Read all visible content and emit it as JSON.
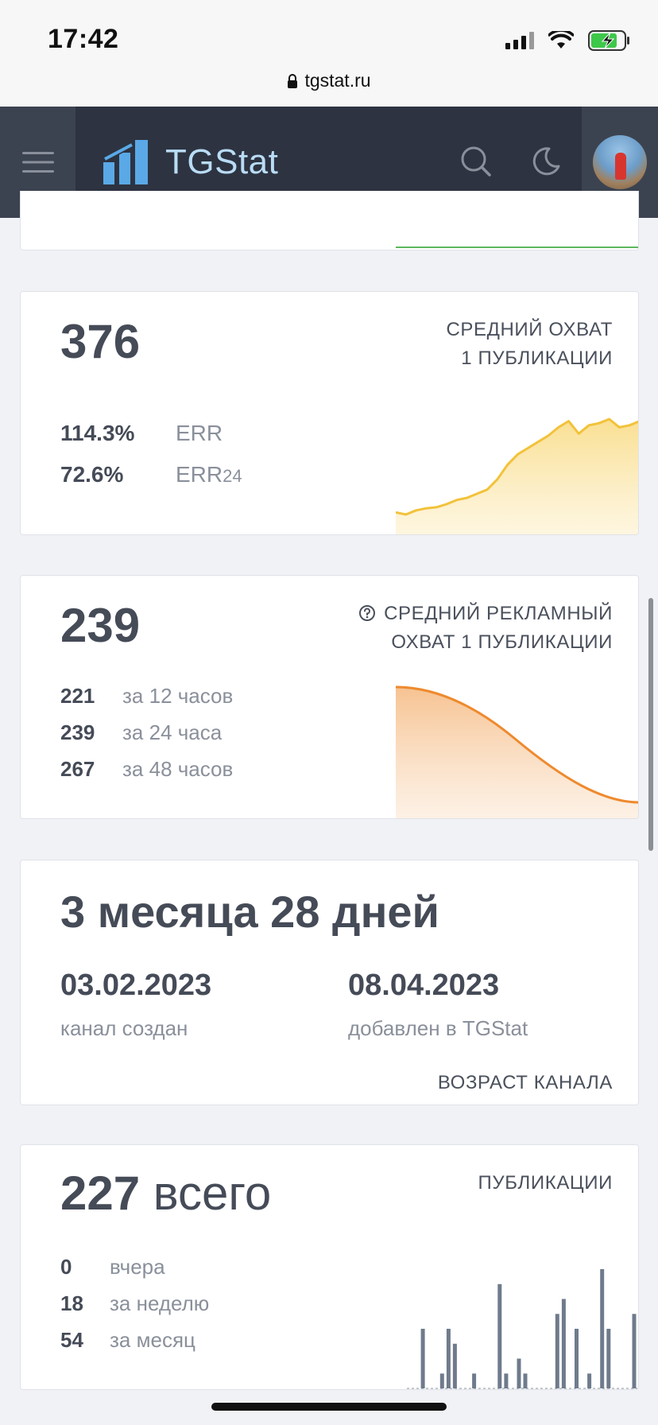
{
  "status": {
    "time": "17:42"
  },
  "browser": {
    "url": "tgstat.ru"
  },
  "header": {
    "brand": "TGStat"
  },
  "reach": {
    "value": "376",
    "title_line1": "СРЕДНИЙ ОХВАТ",
    "title_line2": "1 ПУБЛИКАЦИИ",
    "err_value": "114.3%",
    "err_label": "ERR",
    "err24_value": "72.6%",
    "err24_label": "ERR",
    "err24_sub": "24",
    "trend": [
      12,
      10,
      14,
      16,
      17,
      20,
      24,
      26,
      30,
      34,
      44,
      58,
      68,
      74,
      80,
      86,
      94,
      100,
      88,
      96,
      98,
      102,
      94,
      96,
      100
    ]
  },
  "ad_reach": {
    "value": "239",
    "title_line1": "СРЕДНИЙ РЕКЛАМНЫЙ",
    "title_line2": "ОХВАТ 1 ПУБЛИКАЦИИ",
    "rows": [
      {
        "value": "221",
        "label": "за 12 часов"
      },
      {
        "value": "239",
        "label": "за 24 часа"
      },
      {
        "value": "267",
        "label": "за 48 часов"
      }
    ]
  },
  "age": {
    "value": "3 месяца 28 дней",
    "created_date": "03.02.2023",
    "created_label": "канал создан",
    "added_date": "08.04.2023",
    "added_label": "добавлен в TGStat",
    "title": "ВОЗРАСТ КАНАЛА"
  },
  "posts": {
    "total_num": "227",
    "total_word": "всего",
    "title": "ПУБЛИКАЦИИ",
    "rows": [
      {
        "value": "0",
        "label": "вчера"
      },
      {
        "value": "18",
        "label": "за неделю"
      },
      {
        "value": "54",
        "label": "за месяц"
      }
    ],
    "bars": [
      0,
      0,
      4,
      0,
      0,
      1,
      4,
      3,
      0,
      0,
      1,
      0,
      0,
      0,
      7,
      1,
      0,
      2,
      1,
      0,
      0,
      0,
      0,
      5,
      6,
      0,
      4,
      0,
      1,
      0,
      8,
      4,
      0,
      0,
      0,
      5
    ]
  }
}
